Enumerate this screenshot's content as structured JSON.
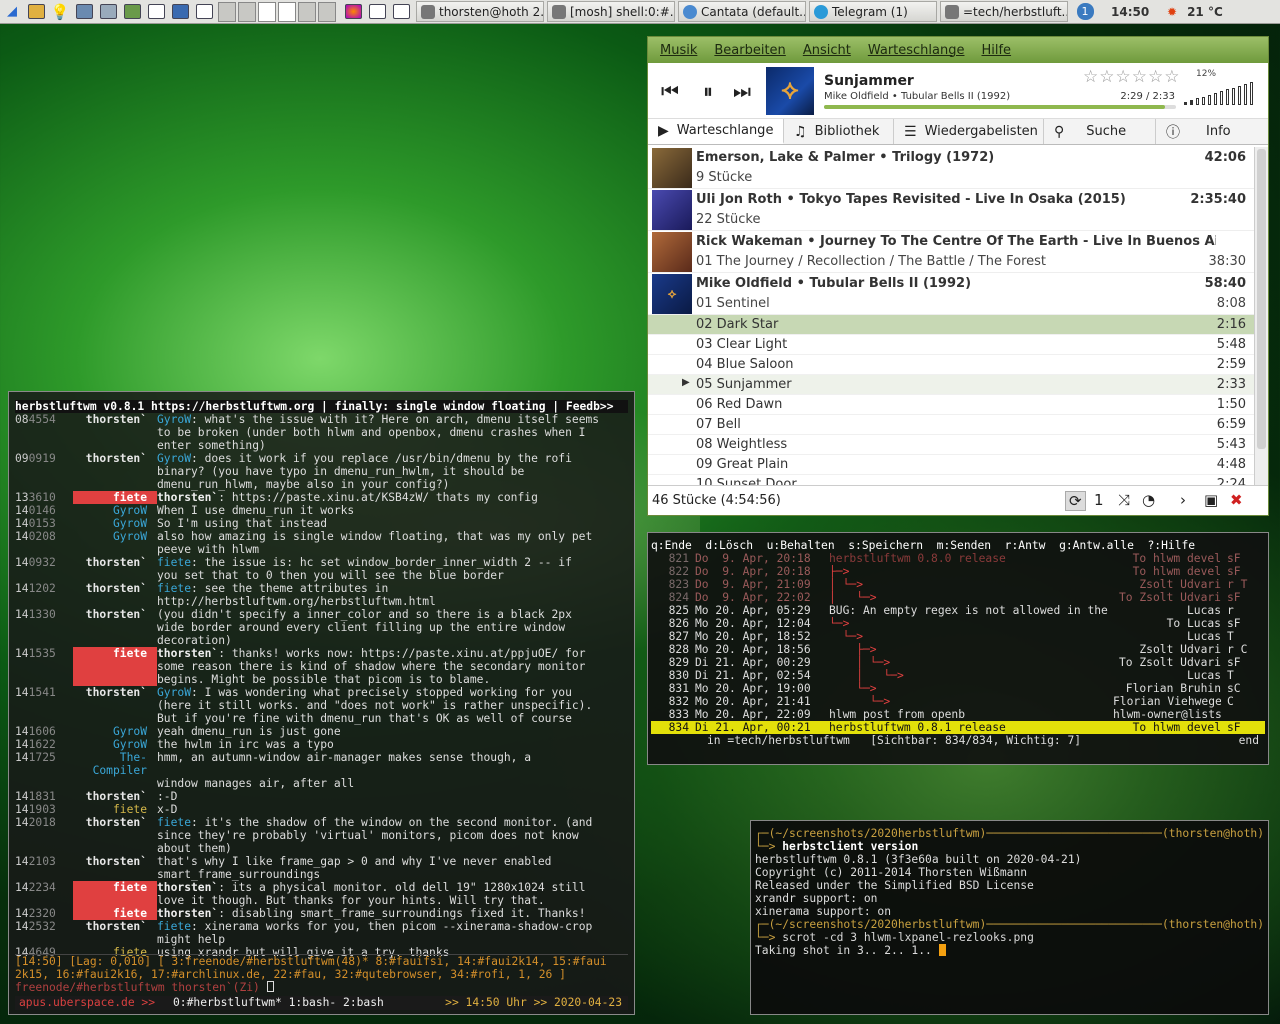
{
  "panel": {
    "launchers": [
      "file-manager-icon",
      "lightbulb-icon",
      "settings-icon",
      "monitor-icon",
      "workspace-icon",
      "window-icon",
      "sync-icon",
      "window-icon"
    ],
    "tasks": [
      {
        "label": "thorsten@hoth 2..."
      },
      {
        "label": "[mosh] shell:0:#..."
      },
      {
        "label": "Cantata (default..."
      },
      {
        "label": "Telegram (1)"
      },
      {
        "label": "=tech/herbstluft..."
      }
    ],
    "notif": "1",
    "clock": "14:50",
    "temp": "21 °C"
  },
  "cantata": {
    "menu": [
      "Musik",
      "Bearbeiten",
      "Ansicht",
      "Warteschlange",
      "Hilfe"
    ],
    "now": {
      "title": "Sunjammer",
      "sub": "Mike Oldfield • Tubular Bells II (1992)",
      "time": "2:29 / 2:33",
      "progress": 0.97
    },
    "rating_stars": "☆☆☆☆☆☆",
    "volume": {
      "label": "12%",
      "level": 0.12
    },
    "tabs": [
      "Warteschlange",
      "Bibliothek",
      "Wiedergabelisten",
      "Suche",
      "Info"
    ],
    "albums": [
      {
        "name": "Emerson, Lake & Palmer • Trilogy (1972)",
        "dur": "42:06",
        "sub": "9 Stücke",
        "subdur": "",
        "cover": "#6a4a2a"
      },
      {
        "name": "Uli Jon Roth • Tokyo Tapes Revisited - Live In Osaka (2015)",
        "dur": "2:35:40",
        "sub": "22 Stücke",
        "subdur": "",
        "cover": "#3a3a8a"
      },
      {
        "name": "Rick Wakeman • Journey To The Centre Of The Earth - Live In Buenos Aires ...",
        "dur": "",
        "sub": "01 The Journey / Recollection / The Battle / The Forest",
        "subdur": "38:30",
        "cover": "#8a4a2a"
      },
      {
        "name": "Mike Oldfield • Tubular Bells II (1992)",
        "dur": "58:40",
        "sub": "01 Sentinel",
        "subdur": "8:08",
        "cover": "#1a3a8a"
      }
    ],
    "tracks": [
      {
        "name": "02 Dark Star",
        "dur": "2:16",
        "state": "sel"
      },
      {
        "name": "03 Clear Light",
        "dur": "5:48",
        "state": ""
      },
      {
        "name": "04 Blue Saloon",
        "dur": "2:59",
        "state": ""
      },
      {
        "name": "05 Sunjammer",
        "dur": "2:33",
        "state": "cur"
      },
      {
        "name": "06 Red Dawn",
        "dur": "1:50",
        "state": ""
      },
      {
        "name": "07 Bell",
        "dur": "6:59",
        "state": ""
      },
      {
        "name": "08 Weightless",
        "dur": "5:43",
        "state": ""
      },
      {
        "name": "09 Great Plain",
        "dur": "4:48",
        "state": ""
      },
      {
        "name": "10 Sunset Door",
        "dur": "2:24",
        "state": ""
      }
    ],
    "status": "46 Stücke (4:54:56)",
    "single": "1"
  },
  "chat": {
    "topic": "herbstluftwm v0.8.1 https://herbstluftwm.org | finally: single window floating | Feedb>>",
    "lines": [
      {
        "t": "08",
        "ts": "4554",
        "nick": "thorsten`",
        "cls": "",
        "lines": [
          "GyroW: what's the issue with it? Here on arch, dmenu itself seems",
          "to be broken (under both hlwm and openbox, dmenu crashes when I",
          "enter something)"
        ]
      },
      {
        "t": "09",
        "ts": "0919",
        "nick": "thorsten`",
        "cls": "",
        "lines": [
          "GyroW: does it work if you replace /usr/bin/dmenu by the rofi",
          "binary?  (you have typo in dmenu_run_hwlm, it should be",
          "dmenu_run_hlwm, maybe also in your config?)"
        ]
      },
      {
        "t": "13",
        "ts": "3610",
        "nick": "fiete",
        "cls": "fi hl",
        "lines": [
          "thorsten`: https://paste.xinu.at/KSB4zW/ thats my config"
        ]
      },
      {
        "t": "14",
        "ts": "0146",
        "nick": "GyroW",
        "cls": "gy",
        "lines": [
          "When I use dmenu_run it works"
        ]
      },
      {
        "t": "14",
        "ts": "0153",
        "nick": "GyroW",
        "cls": "gy",
        "lines": [
          "So I'm using that instead"
        ]
      },
      {
        "t": "14",
        "ts": "0208",
        "nick": "GyroW",
        "cls": "gy",
        "lines": [
          "also how amazing is single window floating, that was my only pet",
          "peeve with hlwm"
        ]
      },
      {
        "t": "14",
        "ts": "0932",
        "nick": "thorsten`",
        "cls": "",
        "lines": [
          "fiete: the issue is: hc set window_border_inner_width 2  -- if",
          "you set that to 0 then you will see the blue border"
        ]
      },
      {
        "t": "14",
        "ts": "1202",
        "nick": "thorsten`",
        "cls": "",
        "lines": [
          "fiete: see the theme attributes in",
          "http://herbstluftwm.org/herbstluftwm.html"
        ]
      },
      {
        "t": "14",
        "ts": "1330",
        "nick": "thorsten`",
        "cls": "",
        "lines": [
          "(you didn't specify a inner_color and so there is a black 2px",
          "wide border around every client filling up the entire window",
          "decoration)"
        ]
      },
      {
        "t": "14",
        "ts": "1535",
        "nick": "fiete",
        "cls": "fi hl",
        "lines": [
          "thorsten`: thanks! works now: https://paste.xinu.at/ppjuOE/ for",
          "some reason there is kind of shadow where the secondary monitor",
          "begins. Might be possible that picom is to blame."
        ]
      },
      {
        "t": "14",
        "ts": "1541",
        "nick": "thorsten`",
        "cls": "",
        "lines": [
          "GyroW: I was wondering what precisely stopped working for you",
          "(here it still works. and \"does not work\" is rather unspecific).",
          "But if you're fine with dmenu_run that's OK as well of course"
        ]
      },
      {
        "t": "14",
        "ts": "1606",
        "nick": "GyroW",
        "cls": "gy",
        "lines": [
          "yeah dmenu_run is just gone"
        ]
      },
      {
        "t": "14",
        "ts": "1622",
        "nick": "GyroW",
        "cls": "gy",
        "lines": [
          "the hwlm in irc was a typo"
        ]
      },
      {
        "t": "14",
        "ts": "1725",
        "nick": "The-Compiler",
        "cls": "tc",
        "lines": [
          "hmm, an autumn-window air-manager makes sense though, a",
          "window manages air, after all"
        ]
      },
      {
        "t": "14",
        "ts": "1831",
        "nick": "thorsten`",
        "cls": "",
        "lines": [
          ":-D"
        ]
      },
      {
        "t": "14",
        "ts": "1903",
        "nick": "fiete",
        "cls": "fy",
        "lines": [
          "x-D"
        ]
      },
      {
        "t": "14",
        "ts": "2018",
        "nick": "thorsten`",
        "cls": "",
        "lines": [
          "fiete: it's the shadow of the window on the second monitor. (and",
          "since they're probably 'virtual' monitors, picom does not know",
          "about them)"
        ]
      },
      {
        "t": "14",
        "ts": "2103",
        "nick": "thorsten`",
        "cls": "",
        "lines": [
          "that's why I like frame_gap > 0 and why I've never enabled",
          "smart_frame_surroundings"
        ]
      },
      {
        "t": "14",
        "ts": "2234",
        "nick": "fiete",
        "cls": "fi hl",
        "lines": [
          "thorsten`: its a physical monitor. old dell 19\" 1280x1024 still",
          "love it though. But thanks for your hints. Will try that."
        ]
      },
      {
        "t": "14",
        "ts": "2320",
        "nick": "fiete",
        "cls": "fi hl",
        "lines": [
          "thorsten`: disabling smart_frame_surroundings fixed it. Thanks!"
        ]
      },
      {
        "t": "14",
        "ts": "2532",
        "nick": "thorsten`",
        "cls": "",
        "lines": [
          "fiete: xinerama works for you, then picom --xinerama-shadow-crop",
          "might help"
        ]
      },
      {
        "t": "14",
        "ts": "4649",
        "nick": "fiete",
        "cls": "fy",
        "lines": [
          "using xrandr but will give it a try. thanks"
        ]
      }
    ],
    "status1": "[14:50] [Lag: 0,010] [ 3:freenode/#herbstluftwm(48)* 8:#fauifsi, 14:#faui2k14, 15:#faui",
    "status2": "2k15, 16:#faui2k16, 17:#archlinux.de, 22:#fau, 32:#qutebrowser, 34:#rofi, 1, 26 ]",
    "input": "freenode/#herbstluftwm thorsten`(Zi)",
    "tmux_host": "apus.uberspace.de >>",
    "tmux_wins": "0:#herbstluftwm* 1:bash- 2:bash",
    "tmux_time": ">> 14:50 Uhr >> 2020-04-23"
  },
  "mail": {
    "header": "q:Ende  d:Lösch  u:Behalten  s:Speichern  m:Senden  r:Antw  g:Antw.alle  ?:Hilfe",
    "rows": [
      {
        "no": "821",
        "date": "Do  9. Apr, 20:18",
        "subj": "herbstluftwm 0.8.0 release",
        "from": "To hlwm devel",
        "flag": "sF",
        "cls": "old",
        "tree": ""
      },
      {
        "no": "822",
        "date": "Do  9. Apr, 20:18",
        "subj": "",
        "from": "To hlwm devel",
        "flag": "sF",
        "cls": "old",
        "tree": "├─>"
      },
      {
        "no": "823",
        "date": "Do  9. Apr, 21:09",
        "subj": "",
        "from": "Zsolt Udvari",
        "flag": "r T",
        "cls": "old",
        "tree": "│ └─>"
      },
      {
        "no": "824",
        "date": "Do  9. Apr, 22:02",
        "subj": "",
        "from": "To Zsolt Udvari",
        "flag": "sF",
        "cls": "old",
        "tree": "│   └─>"
      },
      {
        "no": "825",
        "date": "Mo 20. Apr, 05:29",
        "subj": "BUG: An empty regex is not allowed in the POSIX",
        "from": "Lucas",
        "flag": "r",
        "cls": "",
        "tree": ""
      },
      {
        "no": "826",
        "date": "Mo 20. Apr, 12:04",
        "subj": "",
        "from": "To Lucas",
        "flag": "sF",
        "cls": "",
        "tree": "└─>"
      },
      {
        "no": "827",
        "date": "Mo 20. Apr, 18:52",
        "subj": "",
        "from": "Lucas",
        "flag": "T",
        "cls": "",
        "tree": "  └─>"
      },
      {
        "no": "828",
        "date": "Mo 20. Apr, 18:56",
        "subj": "",
        "from": "Zsolt Udvari",
        "flag": "r C",
        "cls": "",
        "tree": "    ├─>"
      },
      {
        "no": "829",
        "date": "Di 21. Apr, 00:29",
        "subj": "",
        "from": "To Zsolt Udvari",
        "flag": "sF",
        "cls": "",
        "tree": "    │ └─>"
      },
      {
        "no": "830",
        "date": "Di 21. Apr, 02:54",
        "subj": "",
        "from": "Lucas",
        "flag": "T",
        "cls": "",
        "tree": "    │   └─>"
      },
      {
        "no": "831",
        "date": "Mo 20. Apr, 19:00",
        "subj": "",
        "from": "Florian Bruhin",
        "flag": "sC",
        "cls": "",
        "tree": "    └─>"
      },
      {
        "no": "832",
        "date": "Mo 20. Apr, 21:41",
        "subj": "",
        "from": "Florian Viehweger",
        "flag": "C",
        "cls": "",
        "tree": "      └─>"
      },
      {
        "no": "833",
        "date": "Mo 20. Apr, 22:09",
        "subj": "hlwm post from openb",
        "from": "hlwm-owner@lists.herbstluftwm.org",
        "flag": "",
        "cls": "",
        "tree": ""
      },
      {
        "no": "834",
        "date": "Di 21. Apr, 00:21",
        "subj": "herbstluftwm 0.8.1 release",
        "from": "To hlwm devel",
        "flag": "sF",
        "cls": "cur",
        "tree": ""
      }
    ],
    "status": "in =tech/herbstluftwm   [Sichtbar: 834/834, Wichtig: 7]",
    "status_end": "end"
  },
  "shell": {
    "dir": "~/screenshots/2020herbstluftwm",
    "user": "thorsten@hoth",
    "cmd1": "herbstclient",
    "cmd1b": "version",
    "out": [
      "herbstluftwm 0.8.1 (3f3e60a built on 2020-04-21)",
      "Copyright (c) 2011-2014 Thorsten Wißmann",
      "Released under the Simplified BSD License",
      "xrandr support: on",
      "xinerama support: on"
    ],
    "cmd2": "scrot -cd 3 hlwm-lxpanel-rezlooks.png",
    "out2": "Taking shot in 3.. 2.. 1.. "
  }
}
